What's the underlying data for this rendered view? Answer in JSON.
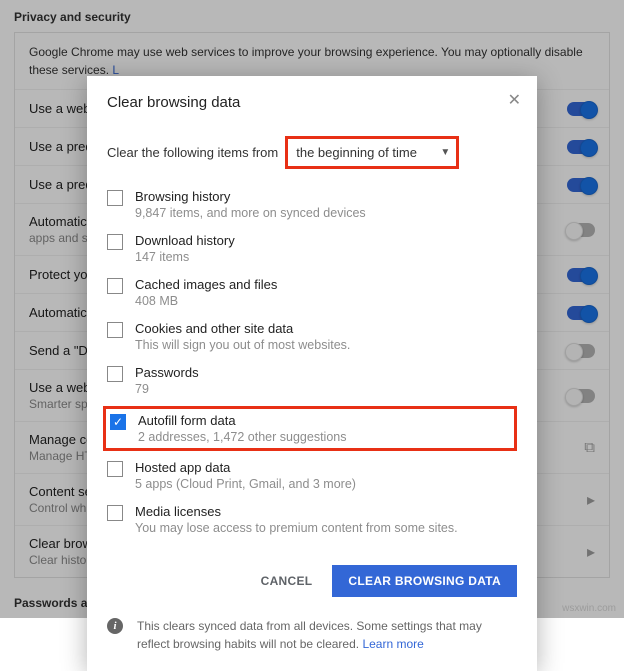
{
  "sections": {
    "privacy_header": "Privacy and security",
    "passwords_header": "Passwords and forms"
  },
  "intro": {
    "text": "Google Chrome may use web services to improve your browsing experience. You may optionally disable these services. ",
    "link": "L"
  },
  "rows": [
    {
      "title": "Use a web",
      "toggle": "on"
    },
    {
      "title": "Use a predi",
      "toggle": "on"
    },
    {
      "title": "Use a predi",
      "toggle": "on"
    },
    {
      "title": "Automatica",
      "sub": "apps and s",
      "toggle": "off"
    },
    {
      "title": "Protect you",
      "toggle": "on"
    },
    {
      "title": "Automatica",
      "toggle": "on"
    },
    {
      "title": "Send a \"Do",
      "toggle": "off"
    },
    {
      "title": "Use a web",
      "sub": "Smarter sp",
      "toggle": "off"
    },
    {
      "title": "Manage ce",
      "sub": "Manage HT",
      "rhs": "link"
    },
    {
      "title": "Content se",
      "sub": "Control wh",
      "rhs": "chev"
    },
    {
      "title": "Clear brows",
      "sub": "Clear histo",
      "rhs": "chev"
    }
  ],
  "dialog": {
    "title": "Clear browsing data",
    "from_label": "Clear the following items from",
    "from_value": "the beginning of time",
    "items": [
      {
        "label": "Browsing history",
        "sub": "9,847 items, and more on synced devices",
        "checked": false
      },
      {
        "label": "Download history",
        "sub": "147 items",
        "checked": false
      },
      {
        "label": "Cached images and files",
        "sub": "408 MB",
        "checked": false
      },
      {
        "label": "Cookies and other site data",
        "sub": "This will sign you out of most websites.",
        "checked": false
      },
      {
        "label": "Passwords",
        "sub": "79",
        "checked": false
      },
      {
        "label": "Autofill form data",
        "sub": "2 addresses, 1,472 other suggestions",
        "checked": true,
        "highlight": true
      },
      {
        "label": "Hosted app data",
        "sub": "5 apps (Cloud Print, Gmail, and 3 more)",
        "checked": false
      },
      {
        "label": "Media licenses",
        "sub": "You may lose access to premium content from some sites.",
        "checked": false
      }
    ],
    "cancel": "CANCEL",
    "confirm": "CLEAR BROWSING DATA",
    "info_text": "This clears synced data from all devices. Some settings that may reflect browsing habits will not be cleared.  ",
    "info_link": "Learn more"
  },
  "watermark": "wsxwin.com"
}
